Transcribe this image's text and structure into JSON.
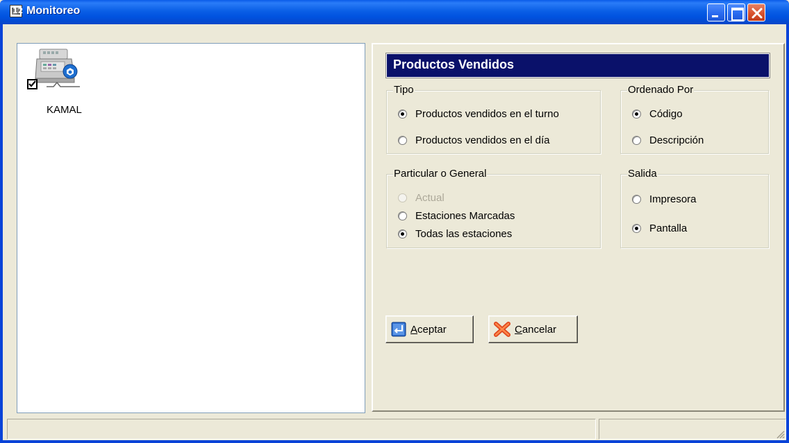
{
  "window": {
    "title": "Monitoreo",
    "app_icon_text": "12"
  },
  "stations": [
    {
      "label": "KAMAL",
      "checked": true
    }
  ],
  "report": {
    "header": "Productos Vendidos",
    "tipo": {
      "legend": "Tipo",
      "options": [
        {
          "label": "Productos vendidos en el turno",
          "selected": true
        },
        {
          "label": "Productos vendidos en el día",
          "selected": false
        }
      ]
    },
    "ordenado": {
      "legend": "Ordenado Por",
      "options": [
        {
          "label": "Código",
          "selected": true
        },
        {
          "label": "Descripción",
          "selected": false
        }
      ]
    },
    "particular": {
      "legend": "Particular o General",
      "options": [
        {
          "label": "Actual",
          "selected": false,
          "disabled": true
        },
        {
          "label": "Estaciones Marcadas",
          "selected": false
        },
        {
          "label": "Todas las estaciones",
          "selected": true
        }
      ]
    },
    "salida": {
      "legend": "Salida",
      "options": [
        {
          "label": "Impresora",
          "selected": false
        },
        {
          "label": "Pantalla",
          "selected": true
        }
      ]
    },
    "buttons": {
      "accept_mnemonic": "A",
      "accept_rest": "ceptar",
      "cancel_mnemonic": "C",
      "cancel_rest": "ancelar"
    }
  },
  "colors": {
    "header_bg": "#0a116a",
    "titlebar": "#0a5be8",
    "face": "#ece9d8"
  }
}
